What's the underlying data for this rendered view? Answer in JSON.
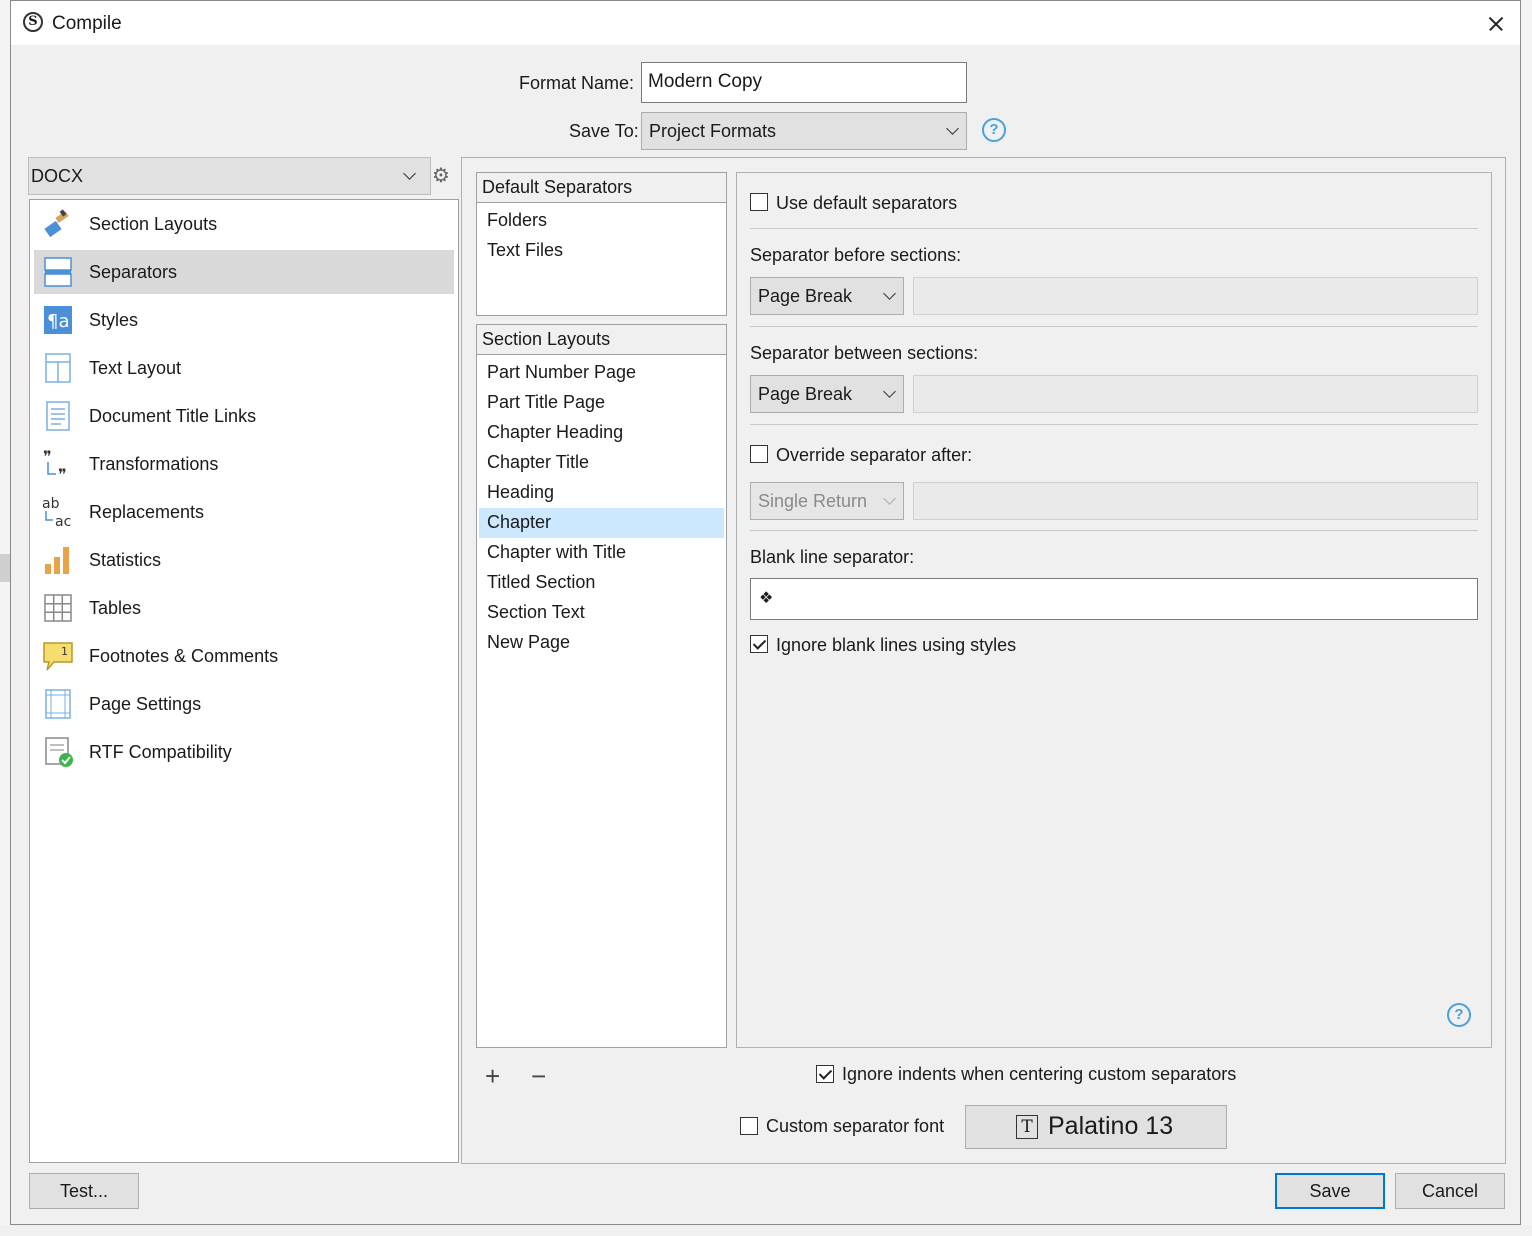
{
  "window": {
    "title": "Compile"
  },
  "header": {
    "format_name_label": "Format Name:",
    "format_name_value": "Modern Copy",
    "save_to_label": "Save To:",
    "save_to_value": "Project Formats",
    "help_glyph": "?"
  },
  "left": {
    "format_combo": "DOCX",
    "gear_glyph": "⚙",
    "items": [
      {
        "label": "Section Layouts",
        "icon": "paintbrush-icon"
      },
      {
        "label": "Separators",
        "icon": "separators-icon",
        "selected": true
      },
      {
        "label": "Styles",
        "icon": "styles-icon"
      },
      {
        "label": "Text Layout",
        "icon": "text-layout-icon"
      },
      {
        "label": "Document Title Links",
        "icon": "document-icon"
      },
      {
        "label": "Transformations",
        "icon": "quotes-icon"
      },
      {
        "label": "Replacements",
        "icon": "replace-icon"
      },
      {
        "label": "Statistics",
        "icon": "bar-chart-icon"
      },
      {
        "label": "Tables",
        "icon": "table-icon"
      },
      {
        "label": "Footnotes & Comments",
        "icon": "footnote-icon"
      },
      {
        "label": "Page Settings",
        "icon": "page-settings-icon"
      },
      {
        "label": "RTF Compatibility",
        "icon": "rtf-check-icon"
      }
    ]
  },
  "default_separators": {
    "header": "Default Separators",
    "items": [
      "Folders",
      "Text Files"
    ]
  },
  "section_layouts": {
    "header": "Section Layouts",
    "items": [
      "Part Number Page",
      "Part Title Page",
      "Chapter Heading",
      "Chapter Title",
      "Heading",
      "Chapter",
      "Chapter with Title",
      "Titled Section",
      "Section Text",
      "New Page"
    ],
    "selected": "Chapter",
    "add_glyph": "+",
    "remove_glyph": "−"
  },
  "settings": {
    "use_default_label": "Use default separators",
    "use_default_checked": false,
    "before_label": "Separator before sections:",
    "before_value": "Page Break",
    "between_label": "Separator between sections:",
    "between_value": "Page Break",
    "override_label": "Override separator after:",
    "override_checked": false,
    "override_value": "Single Return",
    "blank_label": "Blank line separator:",
    "blank_value": "❖",
    "ignore_blank_label": "Ignore blank lines using styles",
    "ignore_blank_checked": true,
    "help_glyph": "?"
  },
  "bottom": {
    "ignore_indents_label": "Ignore indents when centering custom separators",
    "ignore_indents_checked": true,
    "custom_font_label": "Custom separator font",
    "custom_font_checked": false,
    "font_button": "Palatino 13",
    "font_icon_glyph": "T"
  },
  "footer": {
    "test_button": "Test...",
    "save_button": "Save",
    "cancel_button": "Cancel"
  },
  "colors": {
    "accent": "#0078d7",
    "selection": "#cce8ff",
    "help": "#4a9fe0"
  }
}
